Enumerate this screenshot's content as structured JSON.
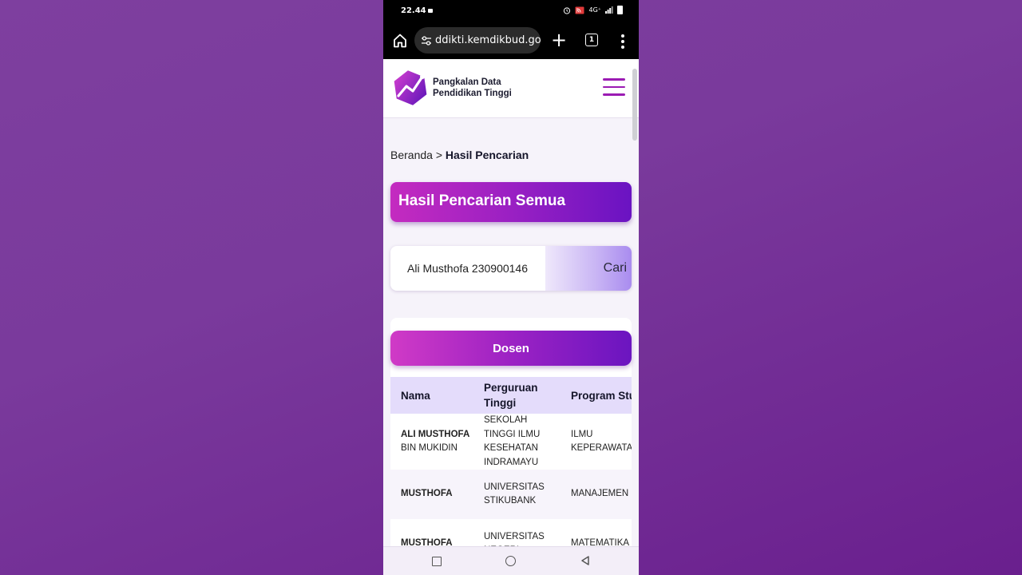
{
  "status_bar": {
    "time": "22.44",
    "network": "4G⁺"
  },
  "browser": {
    "url": "ddikti.kemdikbud.go.id",
    "tab_count": "1"
  },
  "site": {
    "brand_line1": "Pangkalan Data",
    "brand_line2": "Pendidikan Tinggi"
  },
  "colors": {
    "accent_start": "#c42bc0",
    "accent_end": "#6a13c2",
    "table_header": "#e4dcfb"
  },
  "breadcrumb": {
    "home": "Beranda",
    "separator": ">",
    "current": "Hasil Pencarian"
  },
  "page_title": "Hasil Pencarian Semua",
  "search": {
    "value": "Ali Musthofa 230900146",
    "button_label": "Cari"
  },
  "results": {
    "category_label": "Dosen",
    "columns": [
      "Nama",
      "Perguruan Tinggi",
      "Program Studi"
    ],
    "rows": [
      {
        "name_bold": "ALI MUSTHOFA",
        "name_rest": "BIN MUKIDIN",
        "institution": "SEKOLAH TINGGI ILMU KESEHATAN INDRAMAYU",
        "program": "ILMU KEPERAWATAN"
      },
      {
        "name_bold": "MUSTHOFA",
        "name_rest": "",
        "institution": "UNIVERSITAS STIKUBANK",
        "program": "MANAJEMEN"
      },
      {
        "name_bold": "MUSTHOFA",
        "name_rest": "",
        "institution": "UNIVERSITAS NEGERI",
        "program": "MATEMATIKA"
      }
    ]
  }
}
